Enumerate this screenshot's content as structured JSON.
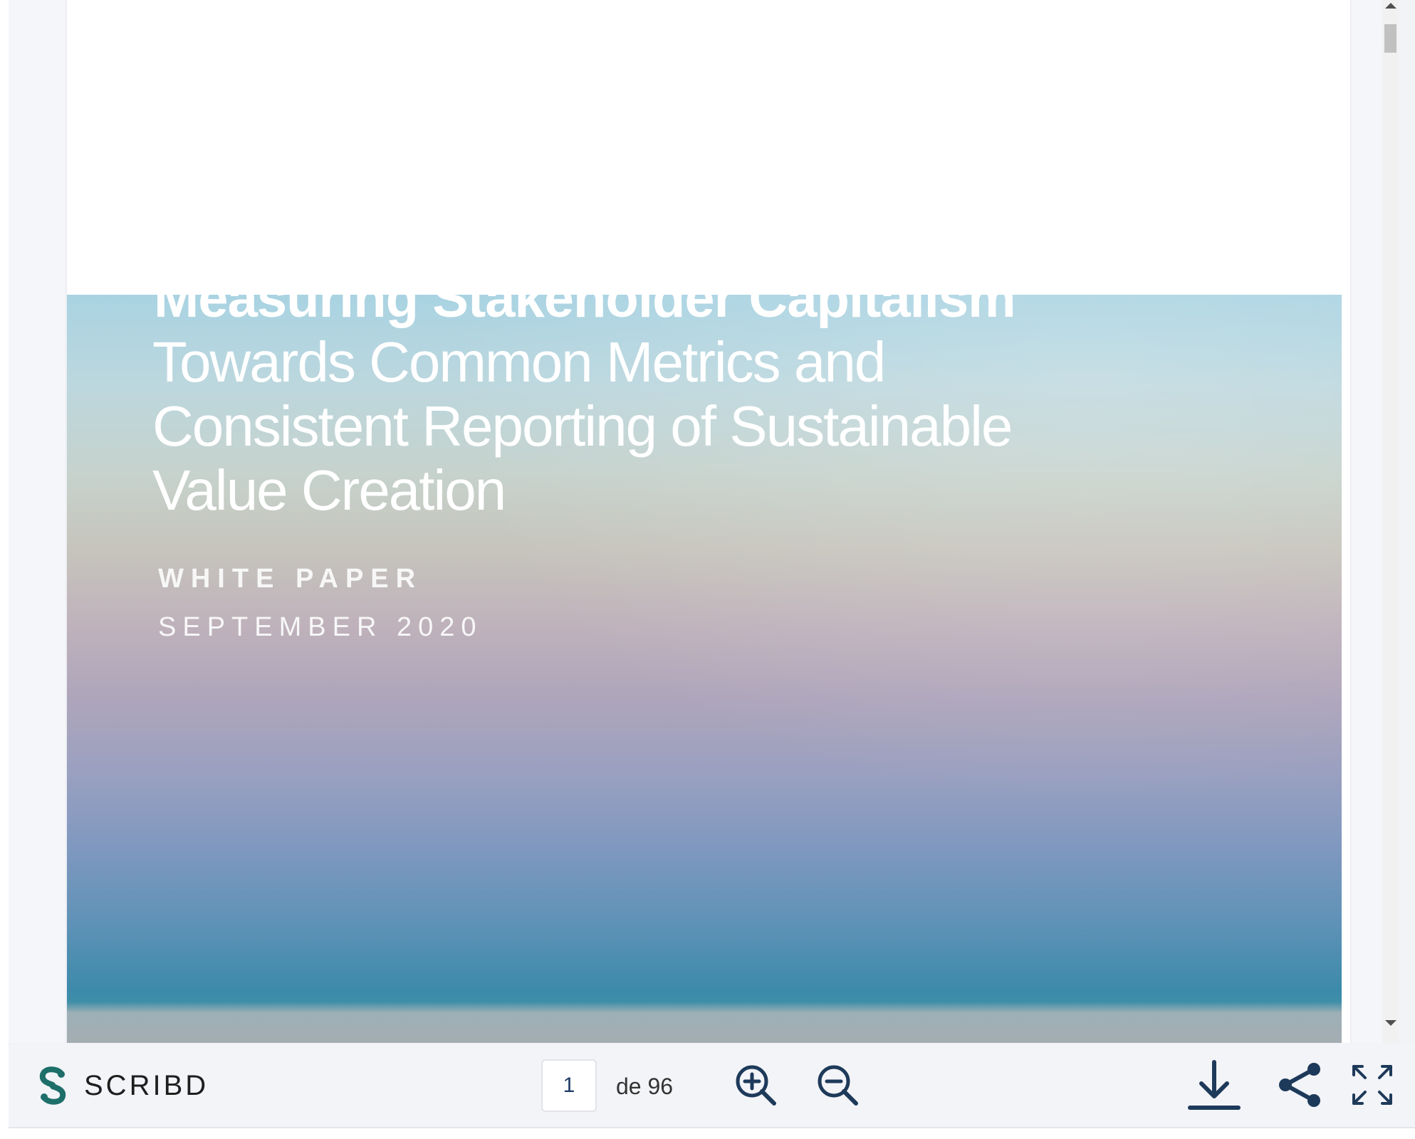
{
  "document": {
    "title": "Measuring Stakeholder Capitalism",
    "subtitle": "Towards Common Metrics and Consistent Reporting of Sustainable Value Creation",
    "kind": "WHITE PAPER",
    "date": "SEPTEMBER 2020"
  },
  "toolbar": {
    "brand_name": "SCRIBD",
    "current_page": "1",
    "page_total": "de 96",
    "icons": [
      "zoom-in-icon",
      "zoom-out-icon",
      "download-icon",
      "share-icon",
      "fullscreen-icon"
    ]
  },
  "colors": {
    "brand": "#1e6f6a",
    "icon": "#1e3a5a",
    "toolbar_background": "#f3f4f8"
  }
}
